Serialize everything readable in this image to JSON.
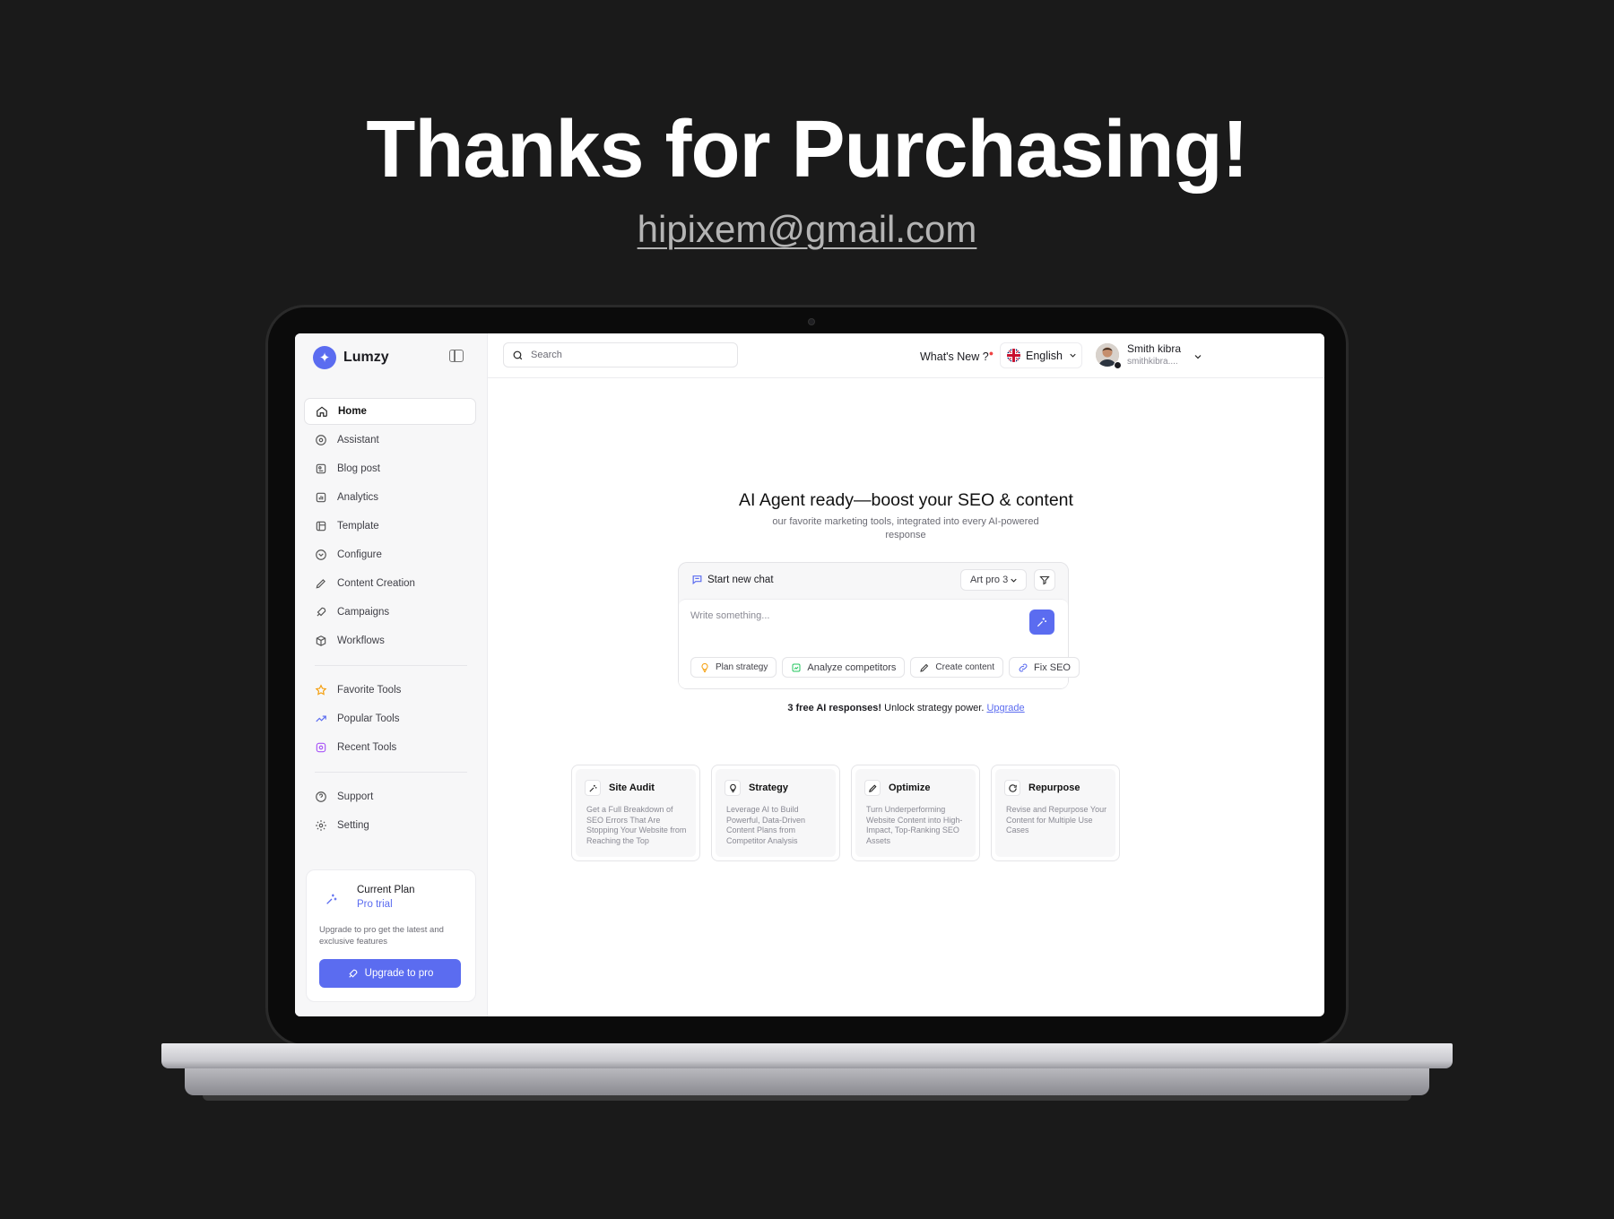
{
  "hero": {
    "title": "Thanks for Purchasing!",
    "email": "hipixem@gmail.com"
  },
  "app": {
    "brand": "Lumzy",
    "accent": "#5b6cf0",
    "sidebar": {
      "main_items": [
        {
          "label": "Home",
          "icon": "home-icon",
          "active": true
        },
        {
          "label": "Assistant",
          "icon": "assistant-icon"
        },
        {
          "label": "Blog post",
          "icon": "blog-icon"
        },
        {
          "label": "Analytics",
          "icon": "analytics-icon"
        },
        {
          "label": "Template",
          "icon": "template-icon"
        },
        {
          "label": "Configure",
          "icon": "configure-icon"
        },
        {
          "label": "Content Creation",
          "icon": "pen-icon"
        },
        {
          "label": "Campaigns",
          "icon": "rocket-icon"
        },
        {
          "label": "Workflows",
          "icon": "cube-icon"
        }
      ],
      "tool_items": [
        {
          "label": "Favorite Tools",
          "icon": "star-icon"
        },
        {
          "label": "Popular Tools",
          "icon": "trending-icon"
        },
        {
          "label": "Recent Tools",
          "icon": "recent-icon"
        }
      ],
      "bottom_items": [
        {
          "label": "Support",
          "icon": "help-icon"
        },
        {
          "label": "Setting",
          "icon": "gear-icon"
        }
      ],
      "plan": {
        "title": "Current Plan",
        "tier": "Pro trial",
        "description": "Upgrade to pro get the latest and exclusive features",
        "button": "Upgrade to pro"
      }
    },
    "topbar": {
      "search_placeholder": "Search",
      "whats_new": "What's New ?",
      "language": "English",
      "user_name": "Smith kibra",
      "user_email": "smithkibra...."
    },
    "main": {
      "headline": "AI Agent ready—boost your SEO & content",
      "subtitle": "our favorite marketing tools, integrated into every AI-powered response",
      "chat": {
        "new_chat": "Start new chat",
        "model": "Art pro 3",
        "placeholder": "Write something...",
        "chips": [
          "Plan strategy",
          "Analyze competitors",
          "Create content",
          "Fix SEO"
        ]
      },
      "free_note": "3 free AI responses! Unlock strategy power.",
      "free_note_strong": "3 free AI responses!",
      "free_note_rest": " Unlock strategy power. ",
      "upgrade_link": "Upgrade",
      "cards": [
        {
          "title": "Site Audit",
          "icon": "sparkle-icon",
          "desc": "Get a Full Breakdown of SEO Errors That Are Stopping Your Website from Reaching the Top"
        },
        {
          "title": "Strategy",
          "icon": "bulb-icon",
          "desc": "Leverage AI to Build Powerful, Data-Driven Content Plans from Competitor Analysis"
        },
        {
          "title": "Optimize",
          "icon": "edit-icon",
          "desc": "Turn Underperforming Website Content into High-Impact, Top-Ranking SEO Assets"
        },
        {
          "title": "Repurpose",
          "icon": "refresh-icon",
          "desc": "Revise and Repurpose Your Content for Multiple Use Cases"
        }
      ]
    }
  }
}
